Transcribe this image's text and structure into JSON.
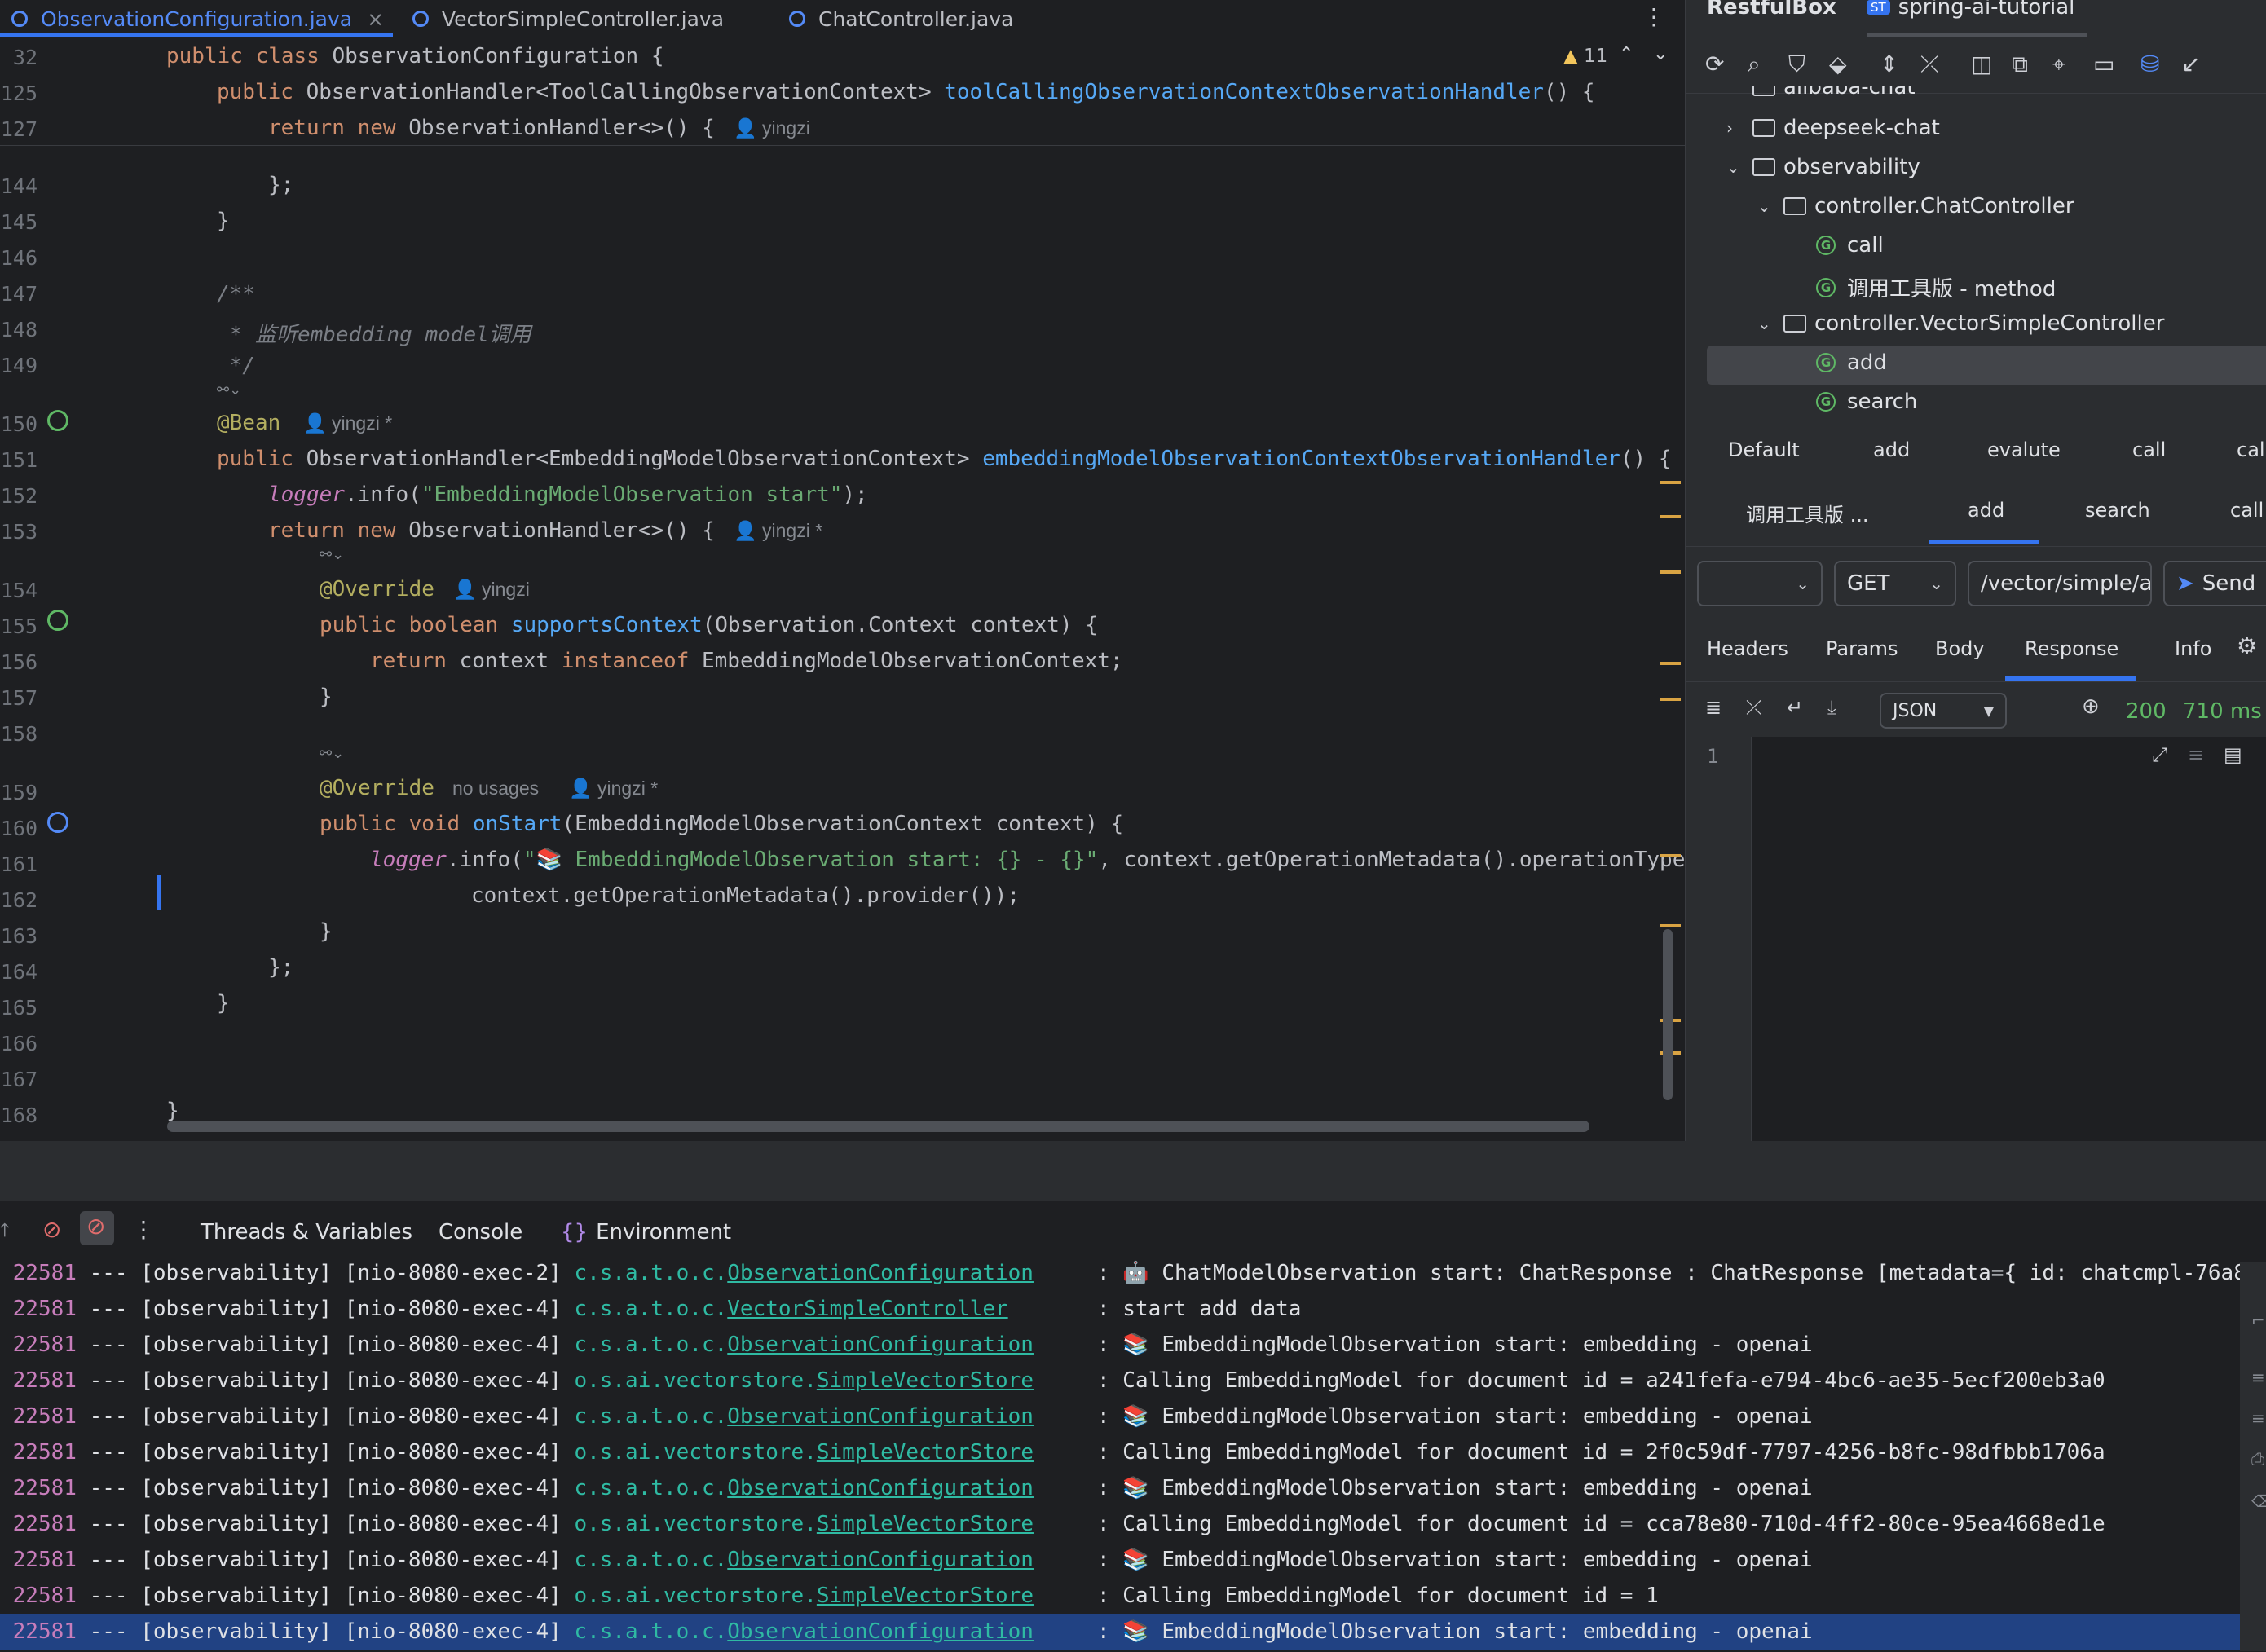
{
  "editor": {
    "tabs": [
      {
        "label": "ObservationConfiguration.java",
        "close": "×"
      },
      {
        "label": "VectorSimpleController.java"
      },
      {
        "label": "ChatController.java"
      }
    ],
    "more_label": "⋮",
    "warning_count": "11",
    "sticky_lines": [
      {
        "num": "32",
        "text": "public class ObservationConfiguration {"
      },
      {
        "num": "125",
        "text": "public ObservationHandler<ToolCallingObservationContext> toolCallingObservationContextObservationHandler() {"
      },
      {
        "num": "127",
        "text": "return new ObservationHandler<>() {"
      }
    ],
    "sticky_author": "yingzi",
    "lines": [
      {
        "num": "144",
        "text": "};"
      },
      {
        "num": "145",
        "text": "}"
      },
      {
        "num": "146",
        "text": ""
      },
      {
        "num": "147",
        "text": "/**"
      },
      {
        "num": "148",
        "text": " * 监听embedding model调用"
      },
      {
        "num": "149",
        "text": " */"
      },
      {
        "num": "150",
        "text": "@Bean"
      },
      {
        "num": "151",
        "text": "public ObservationHandler<EmbeddingModelObservationContext> embeddingModelObservationContextObservationHandler() {"
      },
      {
        "num": "152",
        "text": "logger.info(\"EmbeddingModelObservation start\");"
      },
      {
        "num": "153",
        "text": "return new ObservationHandler<>() {"
      },
      {
        "num": "154",
        "text": "@Override"
      },
      {
        "num": "155",
        "text": "public boolean supportsContext(Observation.Context context) {"
      },
      {
        "num": "156",
        "text": "return context instanceof EmbeddingModelObservationContext;"
      },
      {
        "num": "157",
        "text": "}"
      },
      {
        "num": "158",
        "text": ""
      },
      {
        "num": "159",
        "text": "@Override"
      },
      {
        "num": "160",
        "text": "public void onStart(EmbeddingModelObservationContext context) {"
      },
      {
        "num": "161",
        "text": "logger.info(\"📚 EmbeddingModelObservation start: {} - {}\", context.getOperationMetadata().operationType("
      },
      {
        "num": "162",
        "text": "context.getOperationMetadata().provider());"
      },
      {
        "num": "163",
        "text": "}"
      },
      {
        "num": "164",
        "text": "};"
      },
      {
        "num": "165",
        "text": "}"
      },
      {
        "num": "166",
        "text": ""
      },
      {
        "num": "167",
        "text": ""
      },
      {
        "num": "168",
        "text": "}"
      }
    ],
    "hints": {
      "bean_author": "yingzi *",
      "return_author": "yingzi *",
      "override1_author": "yingzi",
      "override2_usages": "no usages",
      "override2_author": "yingzi *"
    }
  },
  "restfulbox": {
    "title": "RestfulBox",
    "project_badge": "ST",
    "project": "spring-ai-tutorial",
    "tree": [
      {
        "label": "alibaba-chat",
        "kind": "folder",
        "level": 0
      },
      {
        "label": "deepseek-chat",
        "kind": "folder",
        "level": 0,
        "expanded": false
      },
      {
        "label": "observability",
        "kind": "folder",
        "level": 0,
        "expanded": true
      },
      {
        "label": "controller.ChatController",
        "kind": "package",
        "level": 1,
        "expanded": true
      },
      {
        "label": "call",
        "kind": "method",
        "level": 2
      },
      {
        "label": "调用工具版 - method",
        "kind": "method",
        "level": 2
      },
      {
        "label": "controller.VectorSimpleController",
        "kind": "package",
        "level": 1,
        "expanded": true
      },
      {
        "label": "add",
        "kind": "method",
        "level": 2,
        "selected": true
      },
      {
        "label": "search",
        "kind": "method",
        "level": 2
      }
    ],
    "request_tabs_row1": [
      "Default",
      "add",
      "evalute",
      "call",
      "call"
    ],
    "request_tabs_row2": [
      "调用工具版 ...",
      "add",
      "search",
      "call"
    ],
    "active_request_tab": "add",
    "env_select": "",
    "method": "GET",
    "url": "/vector/simple/add",
    "send_label": "Send",
    "detail_tabs": [
      "Headers",
      "Params",
      "Body",
      "Response",
      "Info"
    ],
    "active_detail_tab": "Response",
    "format": "JSON",
    "status_code": "200",
    "elapsed": "710 ms",
    "response_line": "1"
  },
  "debug": {
    "tabs": [
      "Threads & Variables",
      "Console",
      "Environment"
    ],
    "log_rows": [
      {
        "pid": "22581",
        "thread": "--- [observability] [nio-8080-exec-2]",
        "pkg": "c.s.a.t.o.c.",
        "cls": "ObservationConfiguration",
        "msg": ": 🤖 ChatModelObservation start: ChatResponse : ChatResponse [metadata={ id: chatcmpl-76a8"
      },
      {
        "pid": "22581",
        "thread": "--- [observability] [nio-8080-exec-4]",
        "pkg": "c.s.a.t.o.c.",
        "cls": "VectorSimpleController",
        "msg": ": start add data"
      },
      {
        "pid": "22581",
        "thread": "--- [observability] [nio-8080-exec-4]",
        "pkg": "c.s.a.t.o.c.",
        "cls": "ObservationConfiguration",
        "msg": ": 📚 EmbeddingModelObservation start: embedding - openai"
      },
      {
        "pid": "22581",
        "thread": "--- [observability] [nio-8080-exec-4]",
        "pkg": "o.s.ai.vectorstore.",
        "cls": "SimpleVectorStore",
        "msg": ": Calling EmbeddingModel for document id = a241fefa-e794-4bc6-ae35-5ecf200eb3a0"
      },
      {
        "pid": "22581",
        "thread": "--- [observability] [nio-8080-exec-4]",
        "pkg": "c.s.a.t.o.c.",
        "cls": "ObservationConfiguration",
        "msg": ": 📚 EmbeddingModelObservation start: embedding - openai"
      },
      {
        "pid": "22581",
        "thread": "--- [observability] [nio-8080-exec-4]",
        "pkg": "o.s.ai.vectorstore.",
        "cls": "SimpleVectorStore",
        "msg": ": Calling EmbeddingModel for document id = 2f0c59df-7797-4256-b8fc-98dfbbb1706a"
      },
      {
        "pid": "22581",
        "thread": "--- [observability] [nio-8080-exec-4]",
        "pkg": "c.s.a.t.o.c.",
        "cls": "ObservationConfiguration",
        "msg": ": 📚 EmbeddingModelObservation start: embedding - openai"
      },
      {
        "pid": "22581",
        "thread": "--- [observability] [nio-8080-exec-4]",
        "pkg": "o.s.ai.vectorstore.",
        "cls": "SimpleVectorStore",
        "msg": ": Calling EmbeddingModel for document id = cca78e80-710d-4ff2-80ce-95ea4668ed1e"
      },
      {
        "pid": "22581",
        "thread": "--- [observability] [nio-8080-exec-4]",
        "pkg": "c.s.a.t.o.c.",
        "cls": "ObservationConfiguration",
        "msg": ": 📚 EmbeddingModelObservation start: embedding - openai"
      },
      {
        "pid": "22581",
        "thread": "--- [observability] [nio-8080-exec-4]",
        "pkg": "o.s.ai.vectorstore.",
        "cls": "SimpleVectorStore",
        "msg": ": Calling EmbeddingModel for document id = 1"
      },
      {
        "pid": "22581",
        "thread": "--- [observability] [nio-8080-exec-4]",
        "pkg": "c.s.a.t.o.c.",
        "cls": "ObservationConfiguration",
        "msg": ": 📚 EmbeddingModelObservation start: embedding - openai",
        "selected": true
      }
    ]
  },
  "colors": {
    "accent": "#3574f0",
    "keyword": "#cf8e6d",
    "string": "#6aab73",
    "method": "#56a8f5",
    "status_ok": "#5fb865",
    "log_class": "#2fbaa3",
    "selection": "#214283"
  }
}
